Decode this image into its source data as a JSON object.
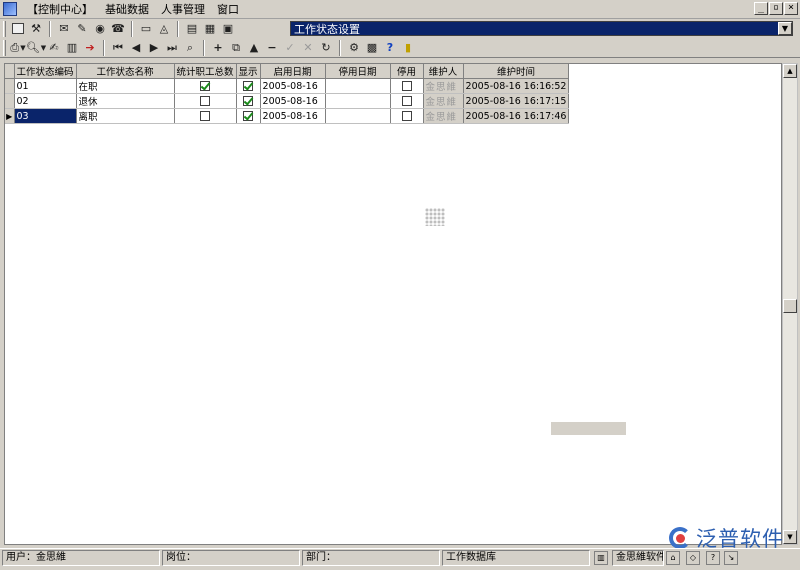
{
  "menu": {
    "items": [
      "【控制中心】",
      "基础数据",
      "人事管理",
      "窗口"
    ]
  },
  "window_controls": [
    "_",
    "▫",
    "×"
  ],
  "form_title": "工作状态设置",
  "grid": {
    "columns": [
      "工作状态编码",
      "工作状态名称",
      "统计职工总数",
      "显示",
      "启用日期",
      "停用日期",
      "停用",
      "维护人",
      "维护时间"
    ],
    "rows": [
      {
        "code": "01",
        "name": "在职",
        "count_staff": true,
        "display": true,
        "start_date": "2005-08-16",
        "stop_date": "",
        "disabled": false,
        "maintainer": "金思維",
        "time": "2005-08-16  16:16:52",
        "selected": false
      },
      {
        "code": "02",
        "name": "退休",
        "count_staff": false,
        "display": true,
        "start_date": "2005-08-16",
        "stop_date": "",
        "disabled": false,
        "maintainer": "金思維",
        "time": "2005-08-16  16:17:15",
        "selected": false
      },
      {
        "code": "03",
        "name": "离职",
        "count_staff": false,
        "display": true,
        "start_date": "2005-08-16",
        "stop_date": "",
        "disabled": false,
        "maintainer": "金思維",
        "time": "2005-08-16  16:17:46",
        "selected": true
      }
    ]
  },
  "status": {
    "user": "用户：金思維",
    "position": "岗位：",
    "department": "部门：",
    "database": "工作数据库",
    "company": "金思維软件"
  },
  "logo": {
    "text": "泛普软件"
  },
  "icons": {
    "toolbar1": [
      "window-icon",
      "tools-icon",
      "mail-icon",
      "edit-icon",
      "globe-icon",
      "phone-icon",
      "monitor-icon",
      "chart-icon",
      "doc-icon",
      "form-icon",
      "report-icon"
    ],
    "toolbar2": [
      "print-icon",
      "preview-icon",
      "edit-icon",
      "calendar-icon",
      "export-icon",
      "first-icon",
      "prev-icon",
      "next-icon",
      "last-icon",
      "find-icon",
      "add-icon",
      "copy-icon",
      "up-icon",
      "delete-icon",
      "confirm-icon",
      "cancel-icon",
      "refresh-icon",
      "group-icon",
      "calc-icon",
      "help-icon",
      "exit-icon"
    ]
  }
}
